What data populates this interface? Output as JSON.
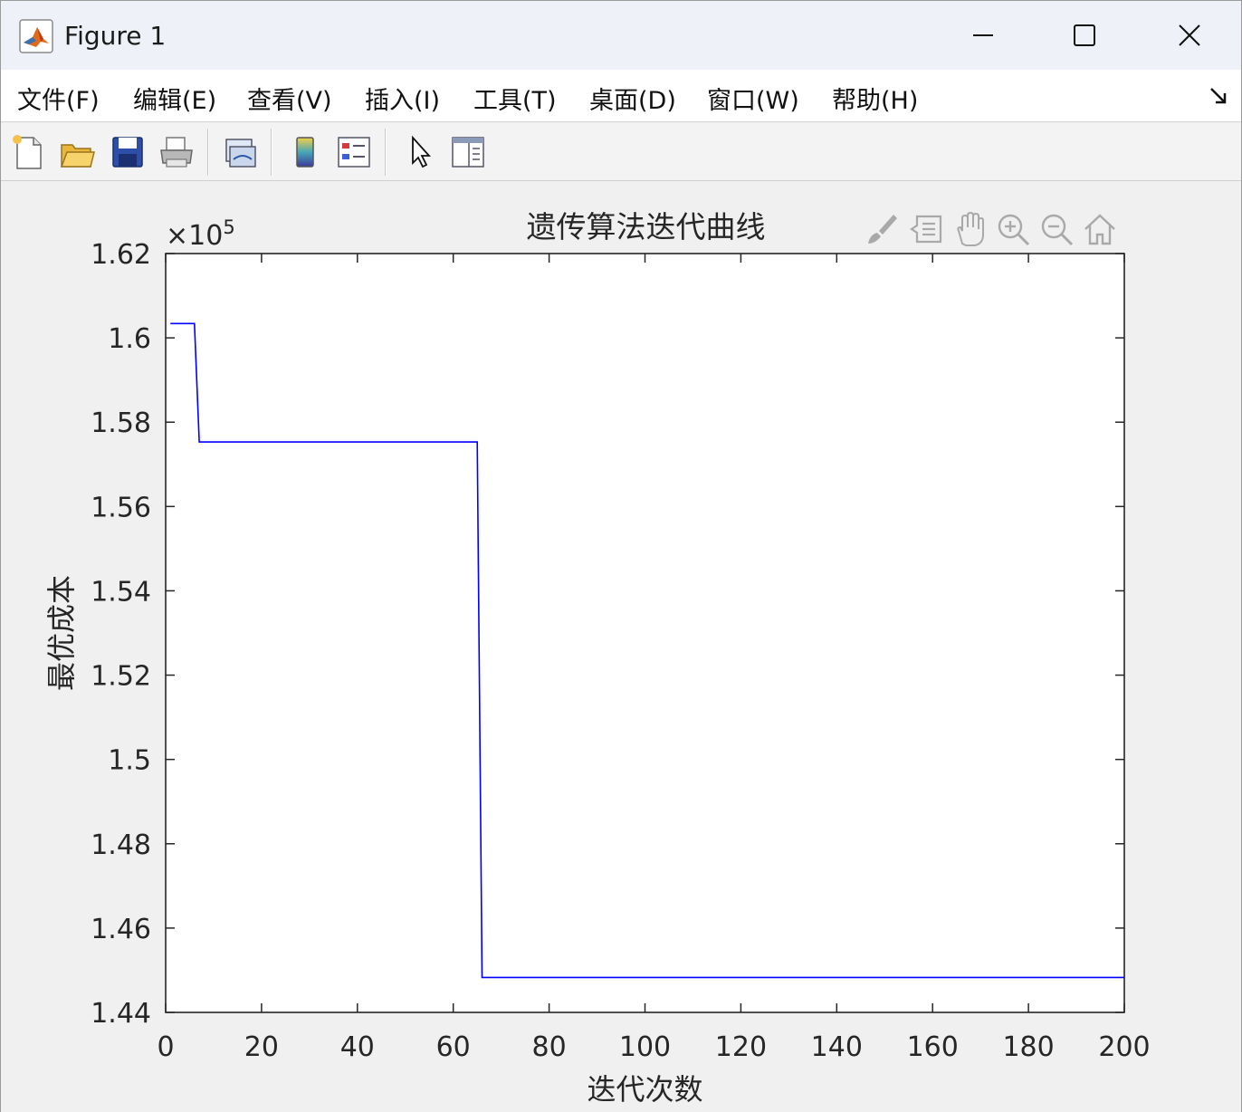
{
  "window": {
    "title": "Figure 1",
    "minimize_glyph": "—",
    "maximize_glyph": "☐",
    "close_glyph": "✕"
  },
  "menu": {
    "items": [
      {
        "label": "文件(F)"
      },
      {
        "label": "编辑(E)"
      },
      {
        "label": "查看(V)"
      },
      {
        "label": "插入(I)"
      },
      {
        "label": "工具(T)"
      },
      {
        "label": "桌面(D)"
      },
      {
        "label": "窗口(W)"
      },
      {
        "label": "帮助(H)"
      }
    ]
  },
  "toolbar": {
    "icons": [
      "new-figure-icon",
      "open-file-icon",
      "save-icon",
      "print-icon",
      "link-plot-icon",
      "colorbar-icon",
      "legend-icon",
      "edit-plot-icon",
      "property-inspector-icon"
    ]
  },
  "axes_toolbar": {
    "icons": [
      "brush-icon",
      "data-tips-icon",
      "pan-icon",
      "zoom-in-icon",
      "zoom-out-icon",
      "restore-view-icon"
    ]
  },
  "chart_data": {
    "type": "line",
    "title": "遗传算法迭代曲线",
    "xlabel": "迭代次数",
    "ylabel": "最优成本",
    "exponent_label": "×10",
    "exponent_power": "5",
    "xlim": [
      0,
      200
    ],
    "ylim": [
      1.44,
      1.62
    ],
    "xticks": [
      "0",
      "20",
      "40",
      "60",
      "80",
      "100",
      "120",
      "140",
      "160",
      "180",
      "200"
    ],
    "yticks": [
      "1.44",
      "1.46",
      "1.48",
      "1.5",
      "1.52",
      "1.54",
      "1.56",
      "1.58",
      "1.6",
      "1.62"
    ],
    "series": [
      {
        "color": "#0000ff",
        "x": [
          1,
          6,
          7,
          65,
          66,
          200
        ],
        "y": [
          1.6034,
          1.6034,
          1.5753,
          1.5753,
          1.4483,
          1.4483
        ]
      }
    ]
  }
}
